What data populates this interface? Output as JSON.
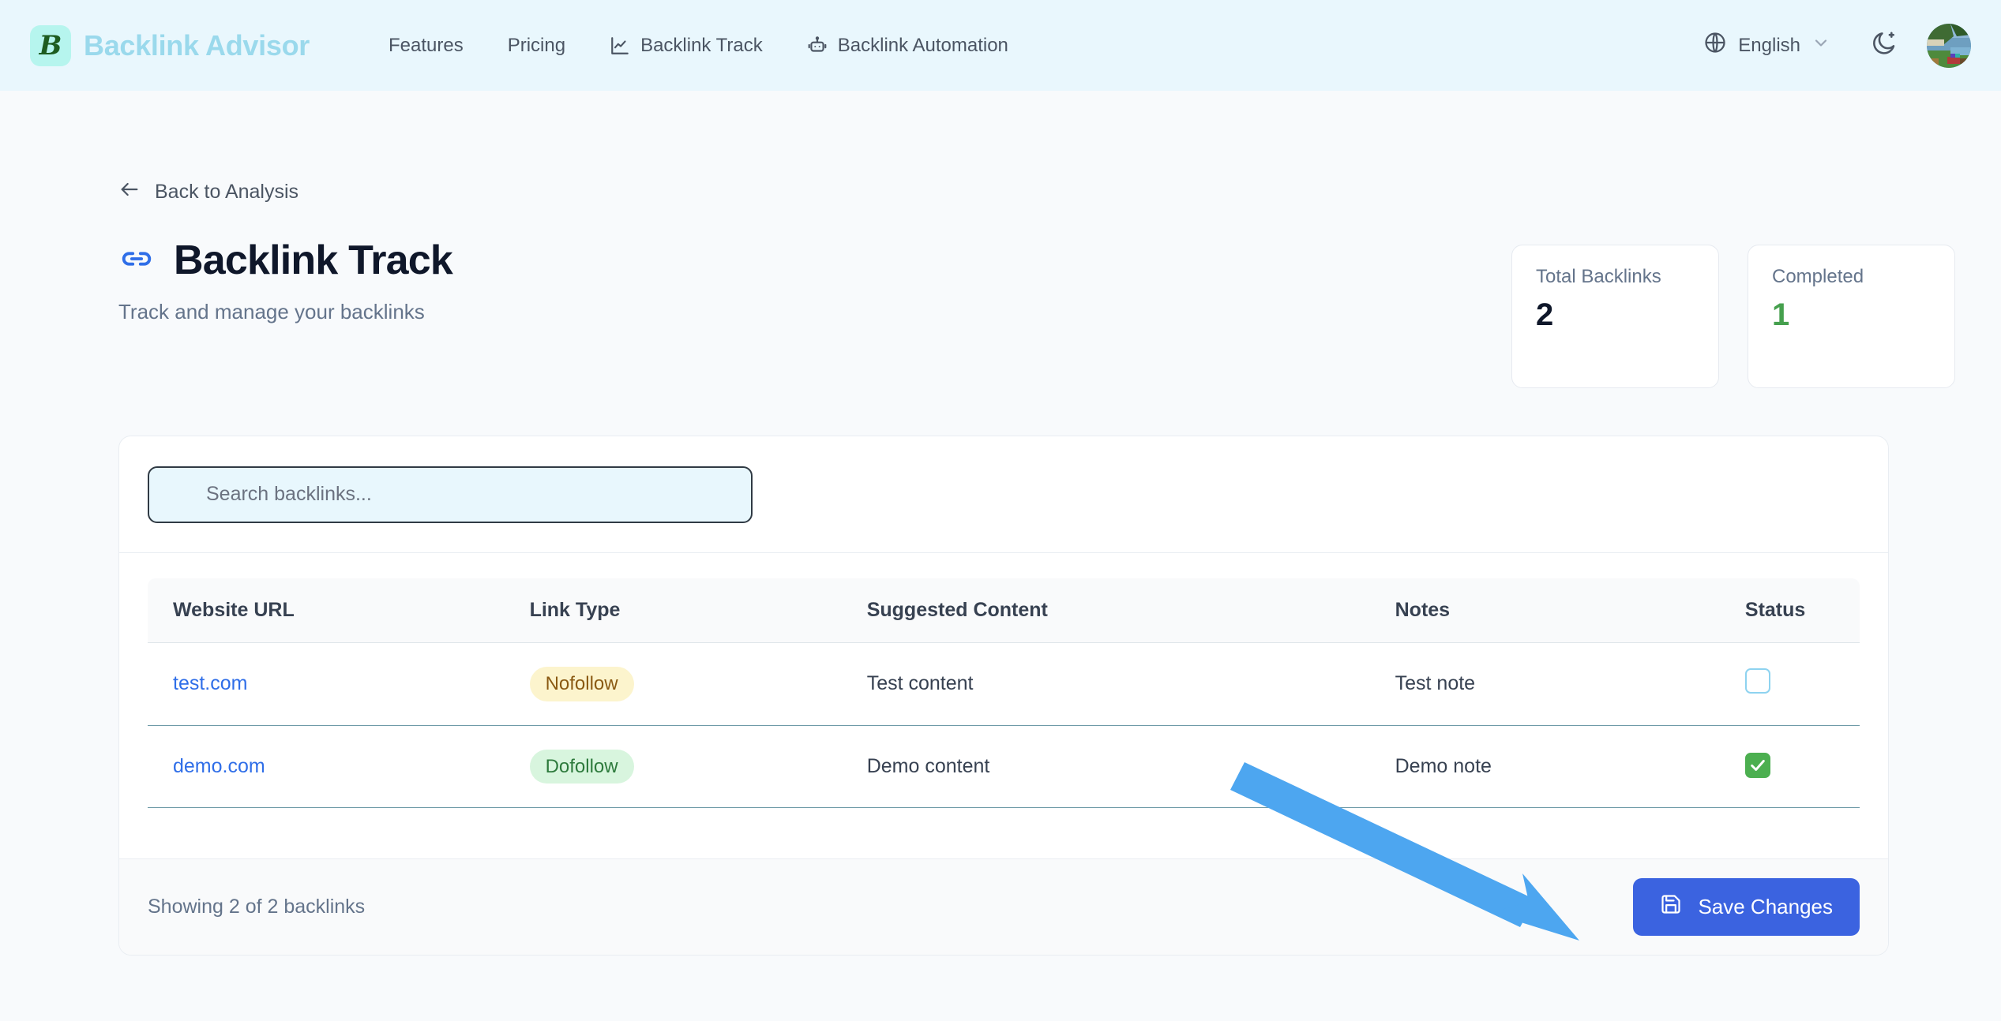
{
  "header": {
    "brand_initial": "B",
    "brand_name": "Backlink Advisor",
    "nav": [
      {
        "label": "Features",
        "icon": ""
      },
      {
        "label": "Pricing",
        "icon": ""
      },
      {
        "label": "Backlink Track",
        "icon": "line-chart-icon"
      },
      {
        "label": "Backlink Automation",
        "icon": "robot-icon"
      }
    ],
    "language": "English",
    "globe_icon": "globe-icon",
    "chevron_icon": "chevron-down-icon",
    "theme_icon": "moon-dark-mode-icon",
    "avatar_icon": "user-avatar"
  },
  "page": {
    "back_label": "Back to Analysis",
    "back_icon": "arrow-left-icon",
    "title": "Backlink Track",
    "title_icon": "link-chain-icon",
    "subtitle": "Track and manage your backlinks"
  },
  "stats": [
    {
      "label": "Total Backlinks",
      "value": "2",
      "color": "#0f172a"
    },
    {
      "label": "Completed",
      "value": "1",
      "color": "#46a04e"
    }
  ],
  "search": {
    "placeholder": "Search backlinks...",
    "value": ""
  },
  "table": {
    "columns": [
      "Website URL",
      "Link Type",
      "Suggested Content",
      "Notes",
      "Status"
    ],
    "rows": [
      {
        "url": "test.com",
        "link_type": "Nofollow",
        "link_type_style": "nofollow",
        "content": "Test content",
        "notes": "Test note",
        "status_checked": false
      },
      {
        "url": "demo.com",
        "link_type": "Dofollow",
        "link_type_style": "dofollow",
        "content": "Demo content",
        "notes": "Demo note",
        "status_checked": true
      }
    ]
  },
  "footer": {
    "showing": "Showing 2 of 2 backlinks",
    "save_label": "Save Changes",
    "save_icon": "save-floppy-disk-icon"
  },
  "annotation": {
    "type": "arrow",
    "color": "#4da6f0",
    "points_to": "save-changes-button"
  },
  "colors": {
    "header_bg": "#e9f7fd",
    "page_bg": "#f8fafc",
    "accent_blue": "#3b63e0",
    "link_blue": "#2f6ee8",
    "brand_text": "#9ad9ec",
    "green": "#4caf50",
    "nofollow_bg": "#fcf4cd",
    "nofollow_text": "#8a5a13",
    "dofollow_bg": "#d8f5de",
    "dofollow_text": "#2d7a3c"
  }
}
